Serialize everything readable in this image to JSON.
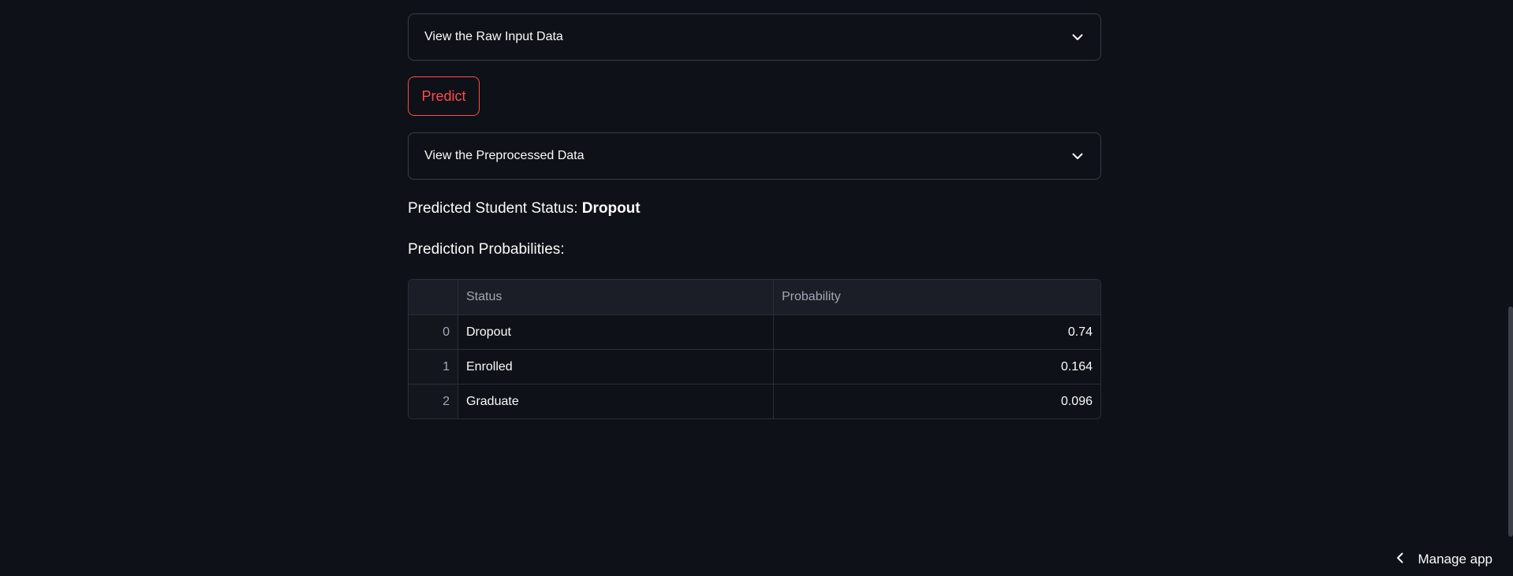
{
  "expanders": {
    "raw_input": {
      "label": "View the Raw Input Data",
      "icon": "chevron-down-icon"
    },
    "preprocessed": {
      "label": "View the Preprocessed Data",
      "icon": "chevron-down-icon"
    }
  },
  "predict_button": {
    "label": "Predict",
    "color": "#ff4b4b"
  },
  "prediction": {
    "prefix": "Predicted Student Status: ",
    "value": "Dropout"
  },
  "probabilities": {
    "heading": "Prediction Probabilities:",
    "columns": [
      "",
      "Status",
      "Probability"
    ],
    "rows": [
      {
        "index": "0",
        "status": "Dropout",
        "probability": "0.74"
      },
      {
        "index": "1",
        "status": "Enrolled",
        "probability": "0.164"
      },
      {
        "index": "2",
        "status": "Graduate",
        "probability": "0.096"
      }
    ]
  },
  "manage_app": {
    "label": "Manage app",
    "icon": "chevron-left-icon"
  },
  "colors": {
    "background": "#0e1117",
    "accent": "#ff4b4b",
    "border": "#3a3d48"
  }
}
